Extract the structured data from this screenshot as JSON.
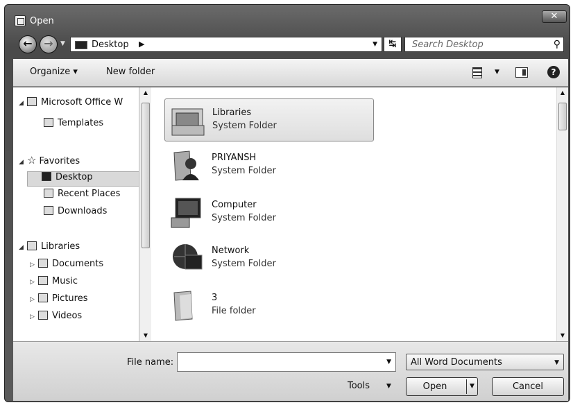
{
  "window": {
    "title": "Open",
    "close_label": "✕"
  },
  "address": {
    "segment": "Desktop",
    "search_placeholder": "Search Desktop"
  },
  "toolbar": {
    "organize": "Organize ▾",
    "new_folder": "New folder"
  },
  "nav": [
    {
      "label": "Microsoft Office W",
      "icon": "word-icon",
      "indent": 0,
      "expander": "◢"
    },
    {
      "label": "Templates",
      "icon": "folder-icon",
      "indent": 1,
      "expander": ""
    },
    {
      "label": "Favorites",
      "icon": "star-icon",
      "indent": 0,
      "expander": "◢"
    },
    {
      "label": "Desktop",
      "icon": "desktop-icon",
      "indent": 1,
      "expander": "",
      "selected": true
    },
    {
      "label": "Recent Places",
      "icon": "recent-places-icon",
      "indent": 1,
      "expander": ""
    },
    {
      "label": "Downloads",
      "icon": "downloads-icon",
      "indent": 1,
      "expander": ""
    },
    {
      "label": "Libraries",
      "icon": "libraries-icon",
      "indent": 0,
      "expander": "◢"
    },
    {
      "label": "Documents",
      "icon": "documents-icon",
      "indent": 1,
      "expander": "▷"
    },
    {
      "label": "Music",
      "icon": "music-icon",
      "indent": 1,
      "expander": "▷"
    },
    {
      "label": "Pictures",
      "icon": "pictures-icon",
      "indent": 1,
      "expander": "▷"
    },
    {
      "label": "Videos",
      "icon": "videos-icon",
      "indent": 1,
      "expander": "▷"
    }
  ],
  "files": [
    {
      "name": "Libraries",
      "type": "System Folder",
      "icon": "libraries-folder-icon",
      "selected": true
    },
    {
      "name": "PRIYANSH",
      "type": "System Folder",
      "icon": "user-folder-icon"
    },
    {
      "name": "Computer",
      "type": "System Folder",
      "icon": "computer-icon"
    },
    {
      "name": "Network",
      "type": "System Folder",
      "icon": "network-icon"
    },
    {
      "name": "3",
      "type": "File folder",
      "icon": "folder-icon"
    }
  ],
  "bottom": {
    "file_name_label": "File name:",
    "file_name_value": "",
    "filter": "All Word Documents",
    "tools": "Tools",
    "open": "Open",
    "cancel": "Cancel"
  }
}
